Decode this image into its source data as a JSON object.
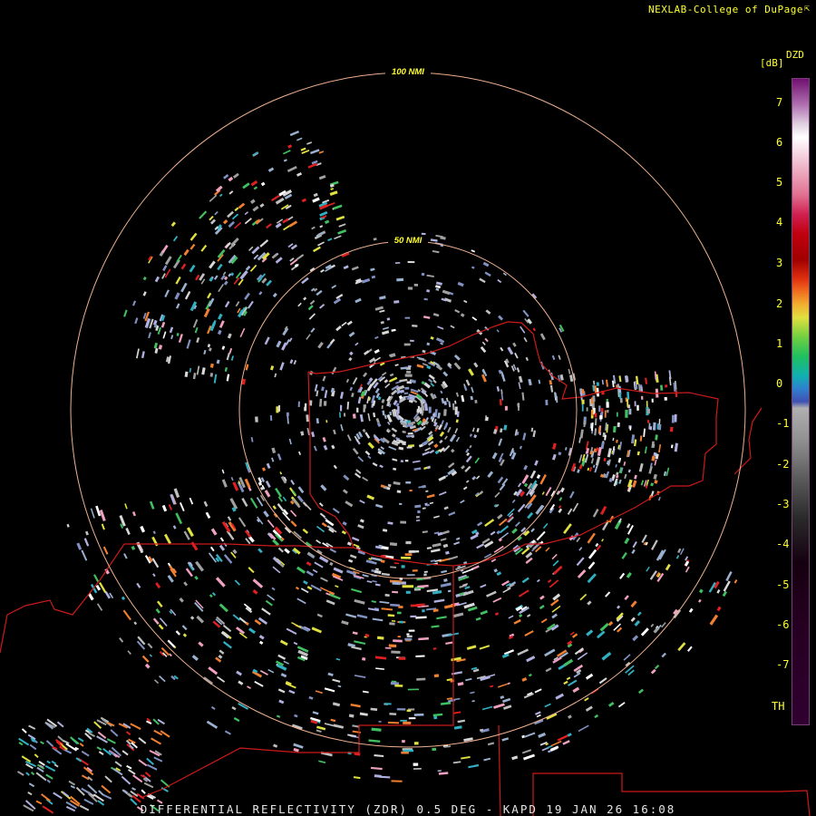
{
  "credit": "NEXLAB-College of DuPage",
  "bottom_title": "DIFFERENTIAL REFLECTIVITY (ZDR) 0.5 DEG - KAPD 19 JAN 26 16:08",
  "colorbar": {
    "product": "DZD",
    "units": "[dB]",
    "labels": [
      "7",
      "6",
      "5",
      "4",
      "3",
      "2",
      "1",
      "0",
      "-1",
      "-2",
      "-3",
      "-4",
      "-5",
      "-6",
      "-7",
      "TH"
    ]
  },
  "range_rings": {
    "inner": "50 NMI",
    "outer": "100 NMI"
  },
  "colors": {
    "ring": "#f0b090",
    "border": "#cc1a1a",
    "label": "#ffff33"
  }
}
